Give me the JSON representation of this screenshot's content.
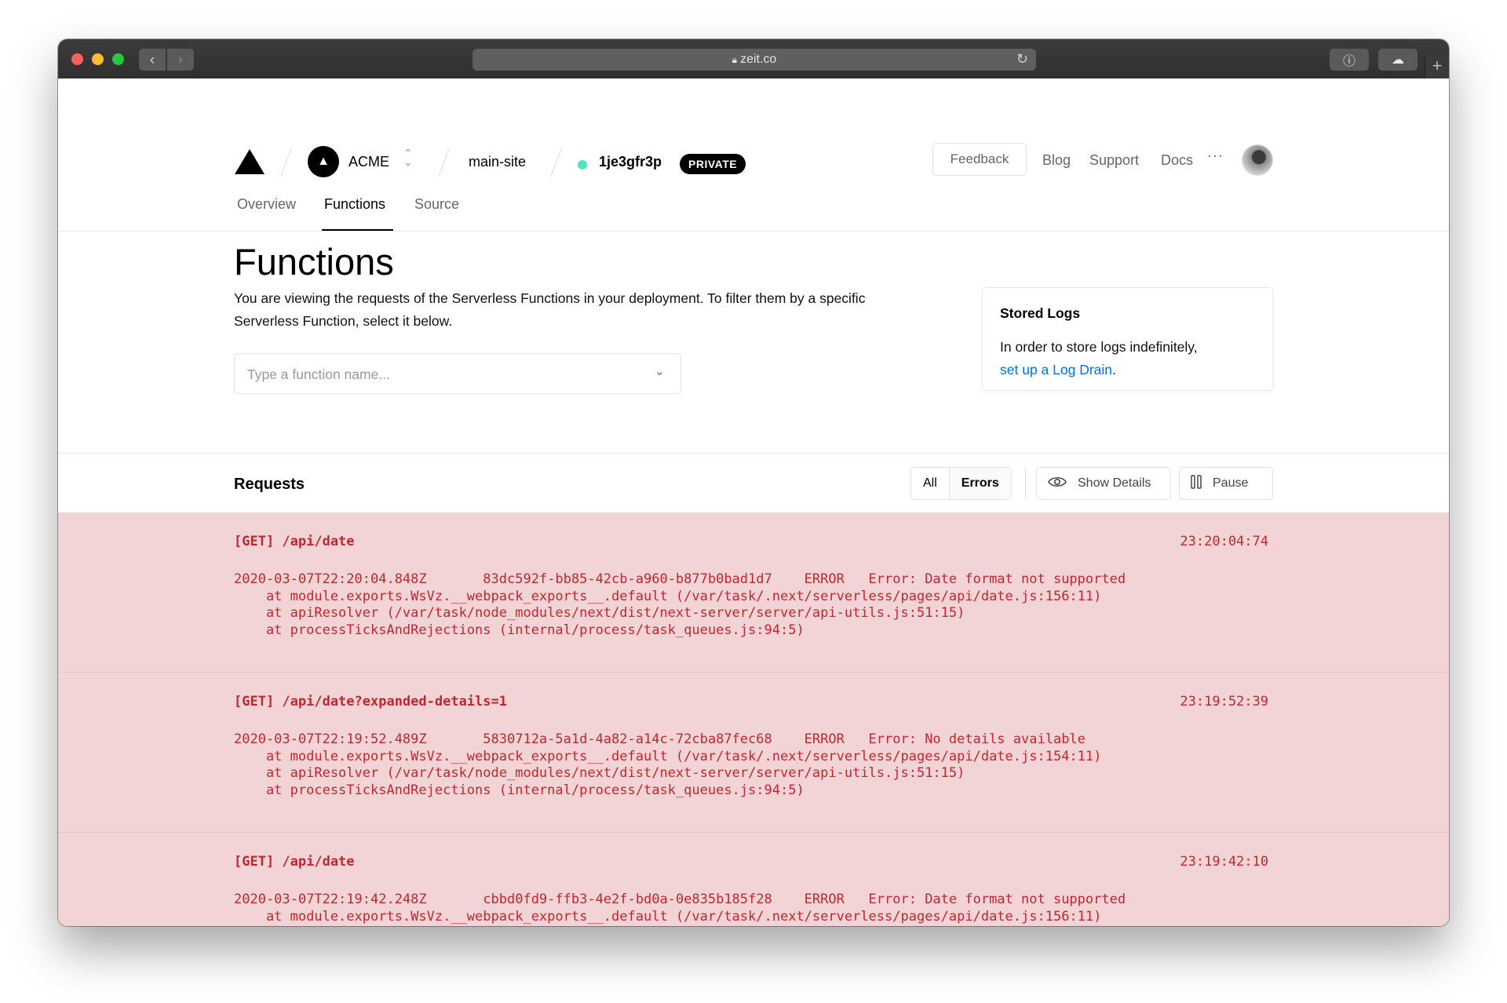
{
  "browser": {
    "url": "zeit.co"
  },
  "header": {
    "team_initial": "▲",
    "team_name": "ACME",
    "project": "main-site",
    "deployment_id": "1je3gfr3p",
    "visibility_badge": "PRIVATE",
    "feedback_label": "Feedback",
    "nav": [
      "Blog",
      "Support",
      "Docs"
    ],
    "more_label": "···"
  },
  "tabs": [
    "Overview",
    "Functions",
    "Source"
  ],
  "active_tab": "Functions",
  "main": {
    "title": "Functions",
    "description": "You are viewing the requests of the Serverless Functions in your deployment. To filter them by a specific Serverless Function, select it below.",
    "function_select_placeholder": "Type a function name..."
  },
  "stored_logs": {
    "title": "Stored Logs",
    "text": "In order to store logs indefinitely,",
    "link": "set up a Log Drain",
    "suffix": "."
  },
  "requests": {
    "title": "Requests",
    "filter_all": "All",
    "filter_errors": "Errors",
    "selected_filter": "Errors",
    "show_details_label": "Show Details",
    "pause_label": "Pause",
    "items": [
      {
        "request": "[GET] /api/date",
        "time": "23:20:04:74",
        "log": "2020-03-07T22:20:04.848Z       83dc592f-bb85-42cb-a960-b877b0bad1d7    ERROR   Error: Date format not supported\n    at module.exports.WsVz.__webpack_exports__.default (/var/task/.next/serverless/pages/api/date.js:156:11)\n    at apiResolver (/var/task/node_modules/next/dist/next-server/server/api-utils.js:51:15)\n    at processTicksAndRejections (internal/process/task_queues.js:94:5)"
      },
      {
        "request": "[GET] /api/date?expanded-details=1",
        "time": "23:19:52:39",
        "log": "2020-03-07T22:19:52.489Z       5830712a-5a1d-4a82-a14c-72cba87fec68    ERROR   Error: No details available\n    at module.exports.WsVz.__webpack_exports__.default (/var/task/.next/serverless/pages/api/date.js:154:11)\n    at apiResolver (/var/task/node_modules/next/dist/next-server/server/api-utils.js:51:15)\n    at processTicksAndRejections (internal/process/task_queues.js:94:5)"
      },
      {
        "request": "[GET] /api/date",
        "time": "23:19:42:10",
        "log": "2020-03-07T22:19:42.248Z       cbbd0fd9-ffb3-4e2f-bd0a-0e835b185f28    ERROR   Error: Date format not supported\n    at module.exports.WsVz.__webpack_exports__.default (/var/task/.next/serverless/pages/api/date.js:156:11)"
      }
    ]
  },
  "colors": {
    "error_text": "#c0272d",
    "error_bg": "#f2d4d6",
    "status_ready": "#50e3c2",
    "link": "#0070f3"
  }
}
